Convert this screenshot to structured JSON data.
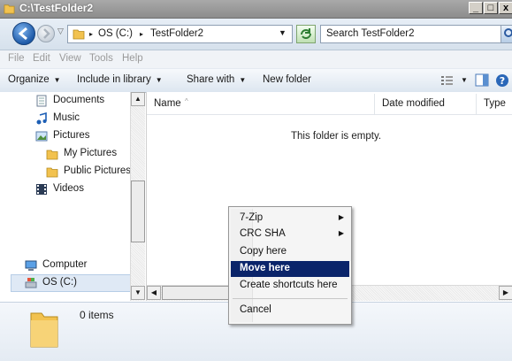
{
  "window": {
    "title": "C:\\TestFolder2"
  },
  "caption_buttons": {
    "minimize": "_",
    "maximize": "□",
    "close": "x"
  },
  "address": {
    "crumbs": [
      "OS (C:)",
      "TestFolder2"
    ],
    "separator": "▸",
    "search_placeholder": "Search TestFolder2"
  },
  "menubar": {
    "items": [
      "File",
      "Edit",
      "View",
      "Tools",
      "Help"
    ]
  },
  "toolbar": {
    "organize": "Organize",
    "include_in_library": "Include in library",
    "share_with": "Share with",
    "new_folder": "New folder"
  },
  "navpane": {
    "items": [
      {
        "label": "Documents",
        "icon": "documents-icon"
      },
      {
        "label": "Music",
        "icon": "music-icon"
      },
      {
        "label": "Pictures",
        "icon": "pictures-icon"
      },
      {
        "label": "My Pictures",
        "icon": "folder-icon"
      },
      {
        "label": "Public Pictures",
        "icon": "folder-icon"
      },
      {
        "label": "Videos",
        "icon": "videos-icon"
      },
      {
        "label": "Computer",
        "icon": "computer-icon"
      },
      {
        "label": "OS (C:)",
        "icon": "drive-icon"
      }
    ]
  },
  "columns": {
    "name": "Name",
    "date_modified": "Date modified",
    "type": "Type"
  },
  "content": {
    "empty_message": "This folder is empty."
  },
  "details": {
    "item_count": "0 items"
  },
  "context_menu": {
    "items": [
      {
        "label": "7-Zip",
        "submenu": true,
        "highlighted": false
      },
      {
        "label": "CRC SHA",
        "submenu": true,
        "highlighted": false
      },
      {
        "label": "Copy here",
        "submenu": false,
        "highlighted": false
      },
      {
        "label": "Move here",
        "submenu": false,
        "highlighted": true
      },
      {
        "label": "Create shortcuts here",
        "submenu": false,
        "highlighted": false
      },
      {
        "label": "Cancel",
        "submenu": false,
        "highlighted": false
      }
    ],
    "submenu_arrow": "▶"
  },
  "colors": {
    "highlight": "#0a246a",
    "folder": "#f2c24f"
  }
}
